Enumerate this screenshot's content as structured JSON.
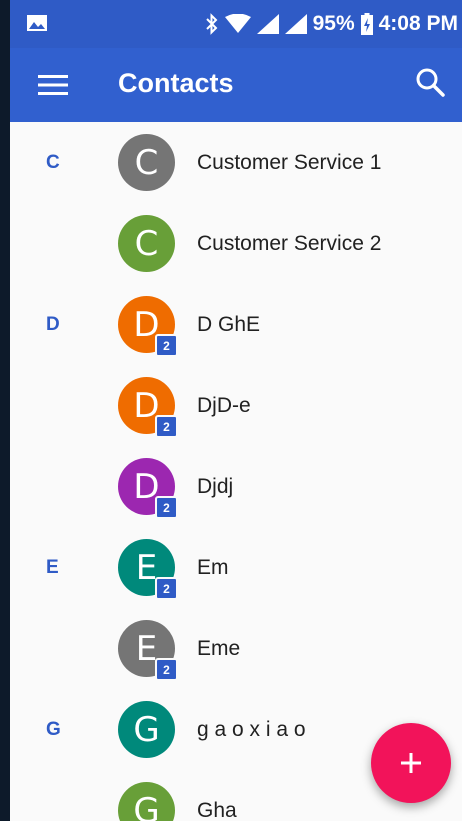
{
  "status_bar": {
    "battery": "95%",
    "time": "4:08 PM"
  },
  "app_bar": {
    "title": "Contacts"
  },
  "colors": {
    "accent": "#3160cf",
    "fab": "#f2135a"
  },
  "contacts": [
    {
      "section": "C",
      "initial": "C",
      "name": "Customer Service 1",
      "avatar_color": "#757575",
      "badge": ""
    },
    {
      "section": "",
      "initial": "C",
      "name": "Customer Service 2",
      "avatar_color": "#689f38",
      "badge": ""
    },
    {
      "section": "D",
      "initial": "D",
      "name": "D GhE",
      "avatar_color": "#ef6c00",
      "badge": "2"
    },
    {
      "section": "",
      "initial": "D",
      "name": "DjD-e",
      "avatar_color": "#ef6c00",
      "badge": "2"
    },
    {
      "section": "",
      "initial": "D",
      "name": "Djdj",
      "avatar_color": "#9c27b0",
      "badge": "2"
    },
    {
      "section": "E",
      "initial": "E",
      "name": "Em",
      "avatar_color": "#00897b",
      "badge": "2"
    },
    {
      "section": "",
      "initial": "E",
      "name": "Eme",
      "avatar_color": "#757575",
      "badge": "2"
    },
    {
      "section": "G",
      "initial": "G",
      "name": "g a o x i a o",
      "avatar_color": "#00897b",
      "badge": ""
    },
    {
      "section": "",
      "initial": "G",
      "name": "Gha",
      "avatar_color": "#689f38",
      "badge": ""
    }
  ],
  "fab": {
    "label": "+"
  }
}
